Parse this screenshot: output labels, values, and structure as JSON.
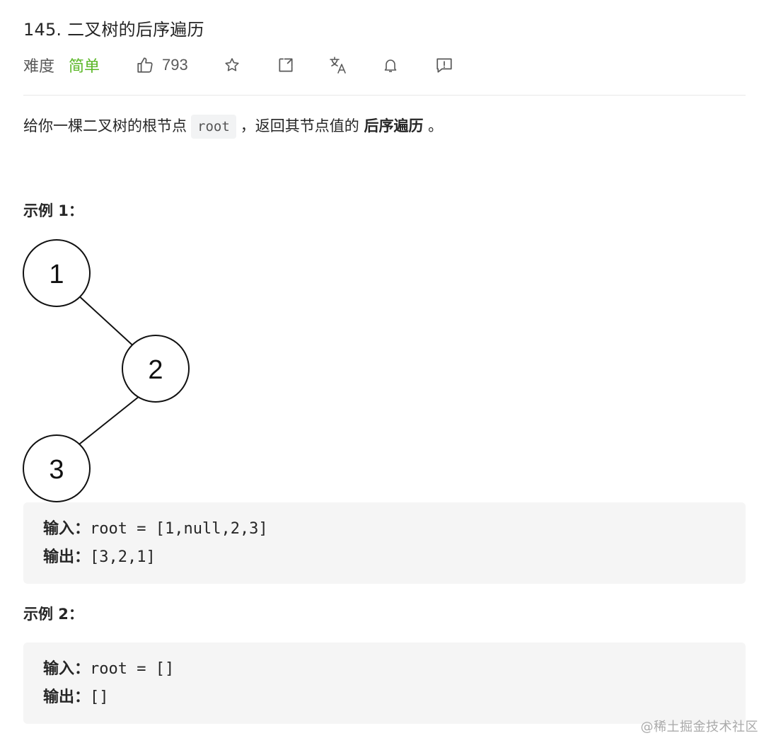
{
  "problem": {
    "title": "145. 二叉树的后序遍历",
    "difficulty_label": "难度",
    "difficulty": "简单",
    "likes": "793"
  },
  "description": {
    "prefix": "给你一棵二叉树的根节点",
    "code": "root",
    "middle": "，返回其节点值的",
    "bold": "后序遍历",
    "suffix": "。"
  },
  "example1": {
    "title": "示例 1：",
    "tree_nodes": [
      "1",
      "2",
      "3"
    ],
    "input_label": "输入：",
    "input_value": "root = [1,null,2,3]",
    "output_label": "输出：",
    "output_value": "[3,2,1]"
  },
  "example2": {
    "title": "示例 2：",
    "input_label": "输入：",
    "input_value": "root = []",
    "output_label": "输出：",
    "output_value": "[]"
  },
  "watermark": "@稀土掘金技术社区",
  "icons": [
    "thumbs-up-icon",
    "star-icon",
    "share-icon",
    "translate-icon",
    "bell-icon",
    "feedback-icon"
  ],
  "colors": {
    "difficulty_easy": "#5ab726",
    "code_bg": "#f5f5f5"
  }
}
